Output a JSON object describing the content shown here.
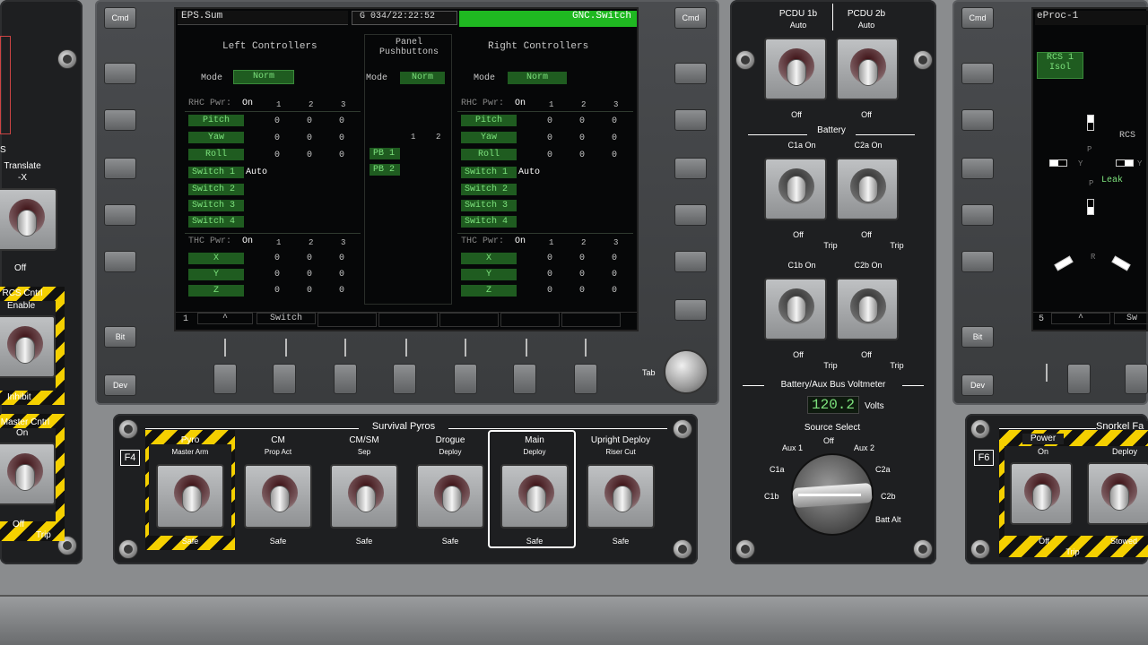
{
  "colors": {
    "accent_green": "#1fb821",
    "screen_bg": "#060708",
    "field_green": "#1f5c20",
    "hazard_yellow": "#f5d000"
  },
  "left_panel": {
    "label_s": "S",
    "translate": "Translate",
    "minus_x": "-X",
    "off": "Off",
    "rcs_cntrl": "RCS Cntrl",
    "enable": "Enable",
    "inhibit": "Inhibit",
    "master_cntrl": "Master Cntrl",
    "on": "On",
    "off2": "Off",
    "trip": "Trip"
  },
  "left_softkeys": {
    "top": "Cmd",
    "bottom1": "Bit",
    "bottom2": "Dev"
  },
  "right_softkeys": {
    "top": "Cmd",
    "b1": "Bit",
    "b2": "Dev"
  },
  "tab_knob": "Tab",
  "display": {
    "left_tab": "EPS.Sum",
    "center_time": "G 034/22:22:52",
    "right_tab": "GNC.Switch",
    "left_title": "Left Controllers",
    "center_title": "Panel Pushbuttons",
    "right_title": "Right Controllers",
    "mode_label": "Mode",
    "mode_value": "Norm",
    "rhc_pwr": "RHC Pwr:",
    "thc_pwr": "THC Pwr:",
    "on": "On",
    "c1": "1",
    "c2": "2",
    "c3": "3",
    "pitch": "Pitch",
    "yaw": "Yaw",
    "roll": "Roll",
    "switch1": "Switch 1",
    "switch2": "Switch 2",
    "switch3": "Switch 3",
    "switch4": "Switch 4",
    "auto": "Auto",
    "x": "X",
    "y": "Y",
    "z": "Z",
    "zero": "0",
    "pb1": "PB 1",
    "pb2": "PB 2",
    "bottom_page": "1",
    "bottom_up": "^",
    "bottom_switch": "Switch"
  },
  "survival_pyros": {
    "title": "Survival Pyros",
    "panel_id": "F4",
    "items": [
      {
        "l1": "Pyro",
        "l2": "Master Arm",
        "bottom": "Safe"
      },
      {
        "l1": "CM",
        "l2": "Prop Act",
        "bottom": "Safe"
      },
      {
        "l1": "CM/SM",
        "l2": "Sep",
        "bottom": "Safe"
      },
      {
        "l1": "Drogue",
        "l2": "Deploy",
        "bottom": "Safe"
      },
      {
        "l1": "Main",
        "l2": "Deploy",
        "bottom": "Safe"
      },
      {
        "l1": "Upright Deploy",
        "l2": "Riser Cut",
        "bottom": "Safe"
      }
    ]
  },
  "pcdu": {
    "p1b": "PCDU 1b",
    "p2b": "PCDU 2b",
    "auto": "Auto",
    "off": "Off"
  },
  "battery": {
    "title": "Battery",
    "c1a_on": "C1a On",
    "c2a_on": "C2a On",
    "c1b_on": "C1b On",
    "c2b_on": "C2b On",
    "off": "Off",
    "trip": "Trip"
  },
  "voltmeter": {
    "title": "Battery/Aux Bus Voltmeter",
    "reading": "120.2",
    "unit": "Volts",
    "source_select": "Source Select",
    "positions": {
      "aux1": "Aux 1",
      "off": "Off",
      "aux2": "Aux 2",
      "c1a": "C1a",
      "c2a": "C2a",
      "c1b": "C1b",
      "c2b": "C2b",
      "batt_alt": "Batt Alt"
    }
  },
  "right_display": {
    "title": "eProc-1",
    "rcs_isol": "RCS 1\nIsol",
    "rcs": "RCS",
    "p": "P",
    "y": "Y",
    "leak": "Leak",
    "r": "R",
    "bottom_page": "5",
    "bottom_up": "^",
    "bottom_sw": "Sw"
  },
  "snorkel": {
    "title": "Snorkel Fa",
    "panel_id": "F6",
    "power": "Power",
    "on": "On",
    "off": "Off",
    "trip": "Trip",
    "deploy": "Deploy",
    "stowed": "Stowed"
  }
}
